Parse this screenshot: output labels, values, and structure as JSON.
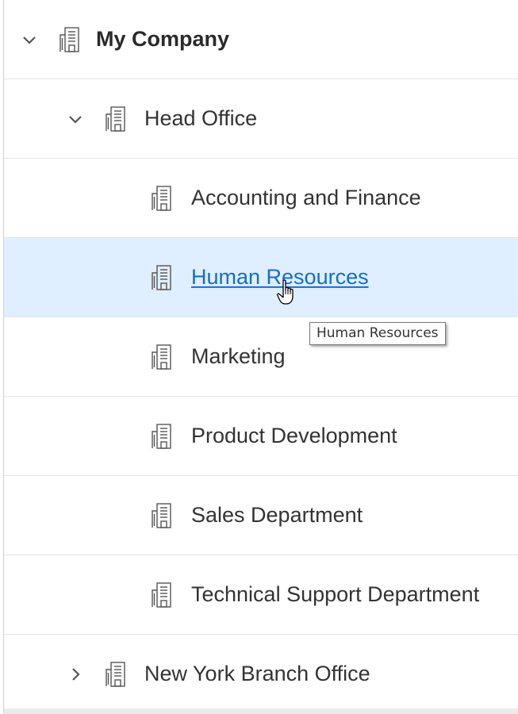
{
  "tree": {
    "nodes": [
      {
        "label": "My Company",
        "level": 0,
        "expanded": true,
        "has_children": true,
        "icon": "building-icon"
      },
      {
        "label": "Head Office",
        "level": 1,
        "expanded": true,
        "has_children": true,
        "icon": "building-icon"
      },
      {
        "label": "Accounting and Finance",
        "level": 2,
        "has_children": false,
        "icon": "building-icon"
      },
      {
        "label": "Human Resources",
        "level": 2,
        "has_children": false,
        "selected": true,
        "hovered": true,
        "icon": "building-icon"
      },
      {
        "label": "Marketing",
        "level": 2,
        "has_children": false,
        "icon": "building-icon"
      },
      {
        "label": "Product Development",
        "level": 2,
        "has_children": false,
        "icon": "building-icon"
      },
      {
        "label": "Sales Department",
        "level": 2,
        "has_children": false,
        "icon": "building-icon"
      },
      {
        "label": "Technical Support Department",
        "level": 2,
        "has_children": false,
        "icon": "building-icon"
      },
      {
        "label": "New York Branch Office",
        "level": 1,
        "expanded": false,
        "has_children": true,
        "icon": "building-icon"
      }
    ]
  },
  "tooltip": {
    "text": "Human Resources"
  },
  "cursor": {
    "type": "hand-pointer-icon"
  },
  "colors": {
    "selected_row": "#dfefff",
    "link": "#1a6cc4",
    "text": "#333333",
    "row_border": "#e6e6e6"
  }
}
